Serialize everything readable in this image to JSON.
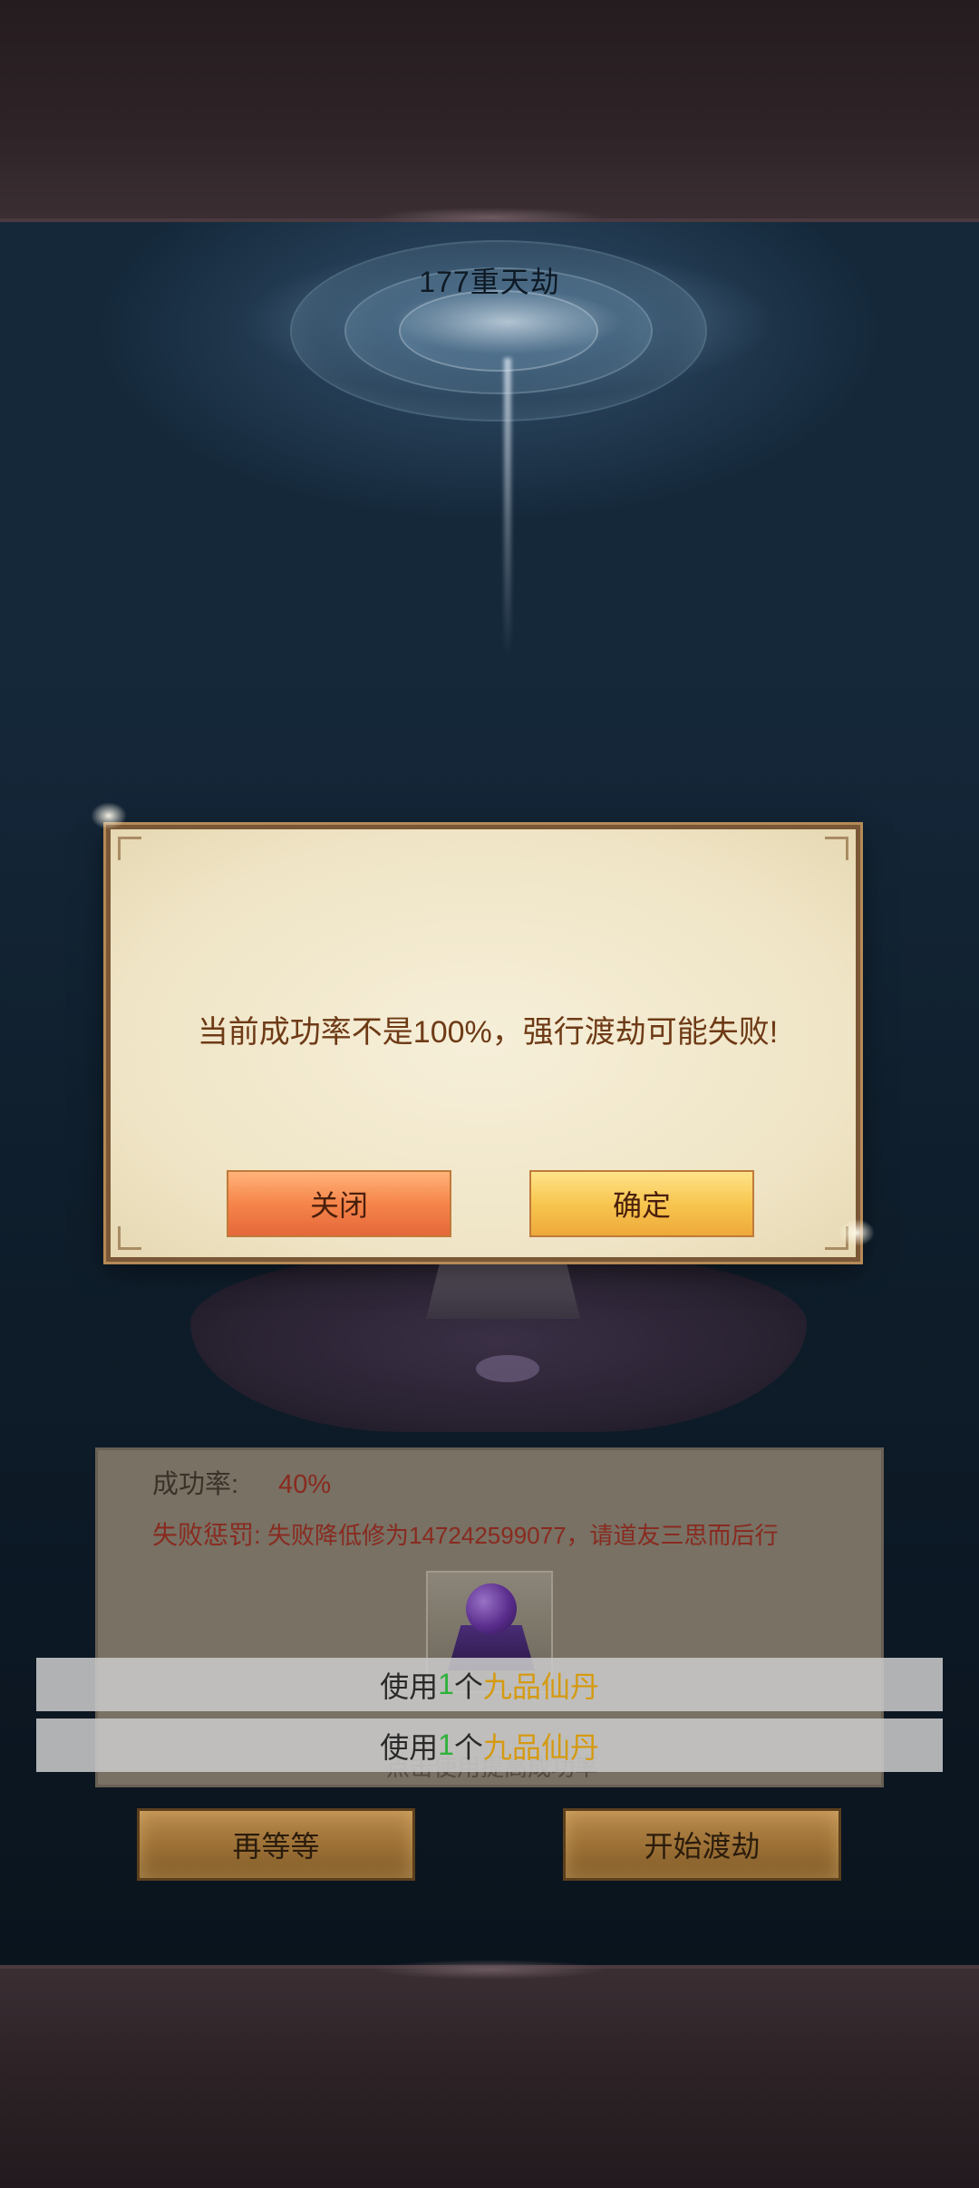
{
  "tribulation": {
    "title": "177重天劫"
  },
  "dialog": {
    "message": "当前成功率不是100%，强行渡劫可能失败!",
    "close_label": "关闭",
    "confirm_label": "确定"
  },
  "panel": {
    "success_rate_label": "成功率:",
    "success_rate_value": "40%",
    "penalty_label": "失败惩罚:",
    "penalty_text": "失败降低修为147242599077，请道友三思而后行",
    "item_icon": "purple-orb-pill-icon",
    "hint_partial": "点击使用提高成功率"
  },
  "toasts": [
    {
      "prefix": "使用",
      "count": "1",
      "unit": "个",
      "item": "九品仙丹"
    },
    {
      "prefix": "使用",
      "count": "1",
      "unit": "个",
      "item": "九品仙丹"
    }
  ],
  "buttons": {
    "wait_label": "再等等",
    "start_label": "开始渡劫"
  },
  "colors": {
    "dialog_bg": "#f1e7c9",
    "dialog_border": "#7a5736",
    "close_button": "#f6854a",
    "confirm_button": "#f7c64f",
    "rate_value": "#8c2b1f",
    "toast_count": "#2fb13b",
    "toast_item": "#d59a12"
  }
}
